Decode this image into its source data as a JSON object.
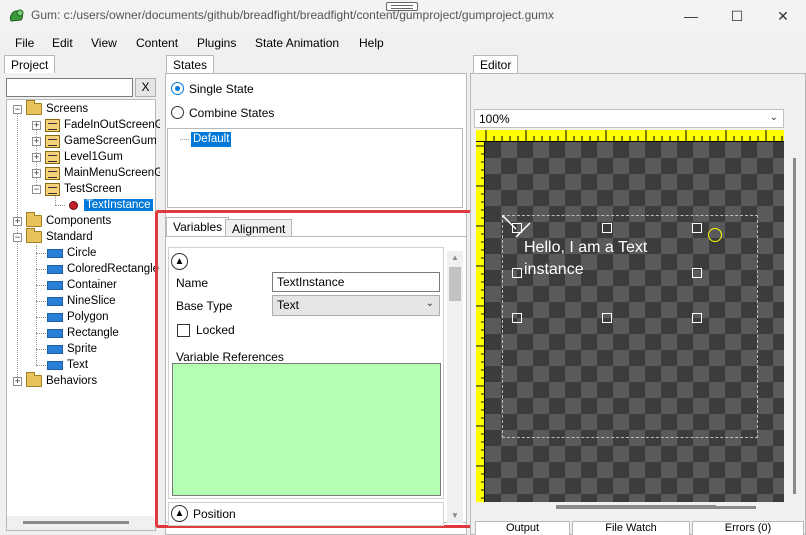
{
  "window": {
    "title": "Gum: c:/users/owner/documents/github/breadfight/breadfight/content/gumproject/gumproject.gumx",
    "minimize": "—",
    "maximize": "☐",
    "close": "✕"
  },
  "menu": [
    "File",
    "Edit",
    "View",
    "Content",
    "Plugins",
    "State Animation",
    "Help"
  ],
  "project": {
    "tab": "Project",
    "clear_button": "X",
    "search_value": "",
    "tree": {
      "screens": "Screens",
      "screen_items": [
        "FadeInOutScreenG",
        "GameScreenGum",
        "Level1Gum",
        "MainMenuScreenG",
        "TestScreen"
      ],
      "instance": "TextInstance",
      "components": "Components",
      "standard": "Standard",
      "standard_items": [
        "Circle",
        "ColoredRectangle",
        "Container",
        "NineSlice",
        "Polygon",
        "Rectangle",
        "Sprite",
        "Text"
      ],
      "behaviors": "Behaviors"
    }
  },
  "states": {
    "tab": "States",
    "single_state": "Single State",
    "combine_states": "Combine States",
    "default_state": "Default"
  },
  "variables": {
    "tab_variables": "Variables",
    "tab_alignment": "Alignment",
    "name_label": "Name",
    "name_value": "TextInstance",
    "base_type_label": "Base Type",
    "base_type_value": "Text",
    "locked_label": "Locked",
    "variable_references_label": "Variable References",
    "position_label": "Position"
  },
  "editor": {
    "tab": "Editor",
    "zoom": "100%",
    "text_instance_content": "Hello, I am a Text instance"
  },
  "status_tabs": [
    "Output",
    "File Watch",
    "Errors (0)"
  ],
  "colors": {
    "highlight_border": "#e0393e",
    "selection": "#0078d7",
    "ruler": "#ffff00",
    "variable_references_bg": "#b3ffb3"
  }
}
